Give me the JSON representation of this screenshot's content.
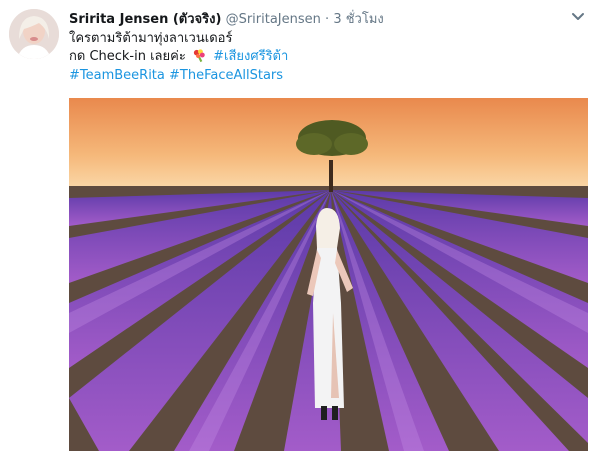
{
  "author": {
    "name": "Sririta Jensen (ตัวจริง)",
    "handle": "@SriritaJensen",
    "separator": "·",
    "time": "3 ชั่วโมง"
  },
  "menu": {
    "icon": "chevron-down-icon"
  },
  "text": {
    "line1": "ใครตามริต้ามาทุ่งลาเวนเดอร์",
    "line2_prefix": "กด Check-in เลยค่ะ",
    "line2_emoji": "bouquet-emoji",
    "line2_hashtag": "#เสียงศรีริต้า",
    "hashtag_1": "#TeamBeeRita",
    "hashtag_2": "#TheFaceAllStars"
  },
  "media": {
    "description_icon": "photo",
    "colors": {
      "sky_top": "#e98e4f",
      "sky_bottom": "#f9d8a3",
      "lavender": "#7a3fb6",
      "lavender_light": "#b07de0",
      "soil": "#5b4a3e"
    }
  }
}
